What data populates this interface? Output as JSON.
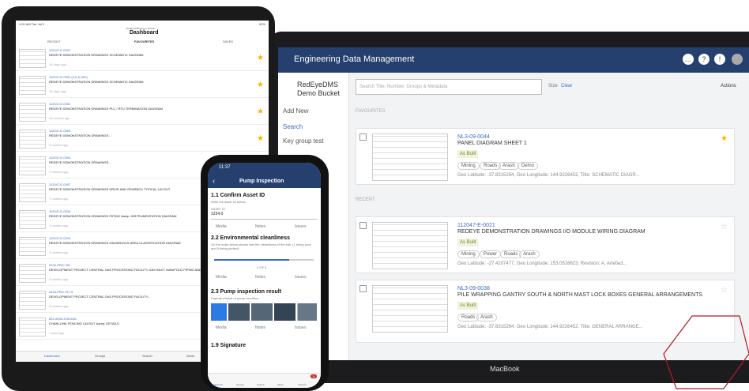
{
  "desktop": {
    "title": "Engineering Data Management",
    "bucket_name": "RedEyeDMS Demo Bucket",
    "add_new": "Add New",
    "search_nav": "Search",
    "group": "Key group test",
    "search_placeholder": "Search Title, Number, Groups & Metadata",
    "size": "Size",
    "clear": "Clear",
    "actions": "Actions",
    "favourites": "FAVOURITES",
    "recent": "RECENT",
    "cards": [
      {
        "code": "NL3-09-0044",
        "title": "PANEL DIAGRAM SHEET 1",
        "status": "As Built",
        "tags": [
          "Mining",
          "Roads",
          "Arash",
          "Demo"
        ],
        "meta": "Geo Latitude: -37.8315264, Geo Longitude: 144.9226452, Title: SCHEMATIC DIAGR..."
      },
      {
        "code": "112047-E-0021",
        "title": "REDEYE DEMONSTRATION DRAWINGS I/O MODULE WIRING DIAGRAM",
        "status": "As Built",
        "tags": [
          "Mining",
          "Power",
          "Roads",
          "Arash"
        ],
        "meta": "Geo Latitude: -27.4207477, Geo Longitude: 153.0518623, Revision: A, Artefact..."
      },
      {
        "code": "NL3-09-0038",
        "title": "PILE WRAPPING GANTRY SOUTH & NORTH MAST LOCK BOXES GENERAL ARRANGEMENTS",
        "status": "As Built",
        "tags": [
          "Roads",
          "Arash"
        ],
        "meta": "Geo Latitude: -37.8315264, Geo Longitude: 144.9226452, Title: GENERAL ARRANGE..."
      }
    ],
    "macbook": "MacBook"
  },
  "tablet": {
    "time": "1:01 AM  Tue Jul 2",
    "battery": "92%",
    "app": "RedEyeDMS Demo Bucket",
    "title": "Dashboard",
    "tabs": [
      "RECENT",
      "FAVOURITES",
      "SAVED"
    ],
    "rows": [
      {
        "code": "112047-E-0031",
        "name": "REDEYE DEMONSTRATION DRAWINGS SCHEMATIC DIAGRAM",
        "time": "18 days ago"
      },
      {
        "code": "112047-E-0001 (CA-D-002)",
        "name": "REDEYE DEMONSTRATION DRAWINGS SCHEMATIC DIAGRAM",
        "time": "18 days ago"
      },
      {
        "code": "112047-E-0002",
        "name": "REDEYE DEMONSTRATION DRAWINGS PLC / RTU TERMINATION DIAGRAM",
        "time": "18 months ago"
      },
      {
        "code": "112047-E-0002",
        "name": "REDEYE DEMONSTRATION DRAWINGS...",
        "time": "5 months ago"
      },
      {
        "code": "112047-E-0003",
        "name": "REDEYE DEMONSTRATION DRAWINGS...",
        "time": "7 months ago"
      },
      {
        "code": "112047-E-0007",
        "name": "REDEYE DEMONSTRATION DRAWINGS DRIVE AND GEARBOX TYPICAL LAYOUT",
        "time": "7 months ago"
      },
      {
        "code": "112047-E-0016",
        "name": "REDEYE DEMONSTRATION DRAWINGS PIPING &amp; INSTRUMENTATION DIAGRAM",
        "time": "7 months ago"
      },
      {
        "code": "112047-E-0018",
        "name": "REDEYE DEMONSTRATION DRAWINGS HAZARDOUS AREA CLASSIFICATION DIAGRAM",
        "time": "4 months ago"
      },
      {
        "code": "0434-PRD-765",
        "name": "DEVELOPMENT PROJECT CENTRAL GAS PROCESSING FACILITY GAS INLET MANIFOLD PIPING AND...",
        "time": "4 months ago"
      },
      {
        "code": "0434-PRD-757-5",
        "name": "DEVELOPMENT PROJECT CENTRAL GAS PROCESSING FACILITY...",
        "time": "4 months ago"
      },
      {
        "code": "801-0000-378-0001",
        "name": "CHAIN-LINK FENCING LAYOUT &amp; DETAILS",
        "time": "1 year ago"
      }
    ],
    "nav": [
      "Dashboard",
      "Groups",
      "Search",
      "Alerts"
    ]
  },
  "phone": {
    "time": "11:37",
    "title": "Pump Inspection",
    "s1": "1.1 Confirm Asset ID",
    "s1sub": "Write the asset ID below:",
    "assetlabel": "ASSET ID",
    "assetval": "1234.0",
    "media": "Media",
    "notes": "Notes",
    "issues": "Issues",
    "s2": "2.2 Environmental cleanliness",
    "s2sub": "On the scale below please rate the cleanliness of the site. (1 being poor and 5 being perfect)",
    "scale": "4 OF 5",
    "s3": "2.3 Pump inspection result",
    "s3sub": "Capture photos of pump condition",
    "s4": "1.9 Signature",
    "nav": [
      "Dashboard",
      "Groups",
      "Search",
      "Alerts",
      "Account"
    ],
    "badge": "11"
  }
}
